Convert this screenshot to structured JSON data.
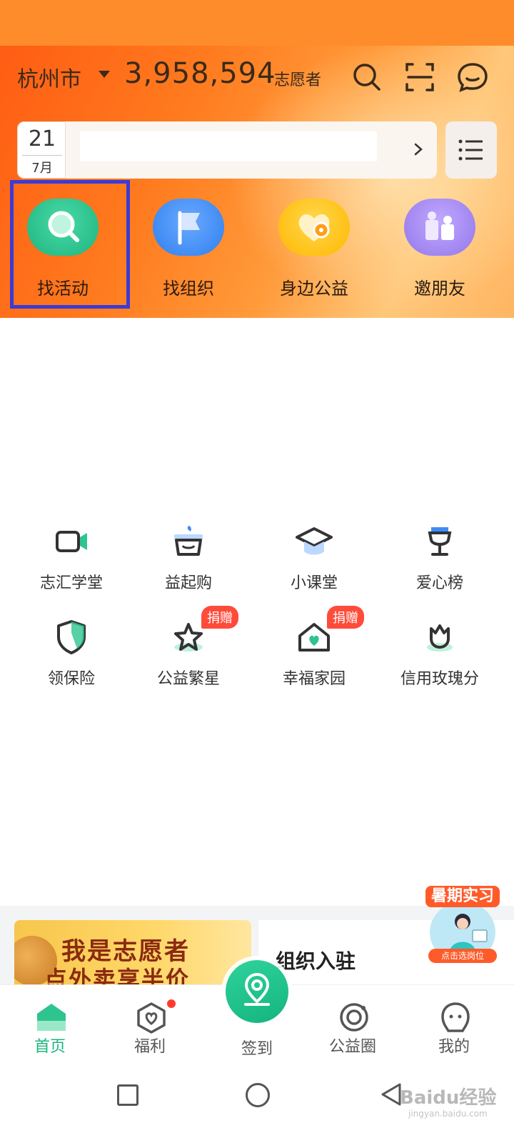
{
  "header": {
    "city": "杭州市",
    "volunteer_count": "3,958,594",
    "volunteer_label": "志愿者"
  },
  "notice": {
    "day": "21",
    "month": "7月"
  },
  "quick_nav": [
    {
      "label": "找活动",
      "icon": "search-icon",
      "color": "#2ec48f"
    },
    {
      "label": "找组织",
      "icon": "flag-icon",
      "color": "#3b8df5"
    },
    {
      "label": "身边公益",
      "icon": "heart-location-icon",
      "color": "#ffc21a"
    },
    {
      "label": "邀朋友",
      "icon": "friends-icon",
      "color": "#a589f0"
    }
  ],
  "shortcuts": [
    {
      "label": "志汇学堂",
      "icon": "video-icon"
    },
    {
      "label": "益起购",
      "icon": "basket-icon"
    },
    {
      "label": "小课堂",
      "icon": "graduation-cap-icon"
    },
    {
      "label": "爱心榜",
      "icon": "trophy-icon"
    },
    {
      "label": "领保险",
      "icon": "shield-icon"
    },
    {
      "label": "公益繁星",
      "icon": "star-icon",
      "badge": "捐赠"
    },
    {
      "label": "幸福家园",
      "icon": "home-icon",
      "badge": "捐赠"
    },
    {
      "label": "信用玫瑰分",
      "icon": "rose-icon"
    }
  ],
  "banner": {
    "left_line1": "我是志愿者",
    "left_line2": "点外卖享半价",
    "right_title": "组织入驻"
  },
  "summer": {
    "title": "暑期实习",
    "cta": "点击选岗位"
  },
  "tabbar": {
    "tabs": [
      {
        "label": "首页",
        "active": true
      },
      {
        "label": "福利",
        "active": false
      },
      {
        "label": "签到",
        "active": false
      },
      {
        "label": "公益圈",
        "active": false
      },
      {
        "label": "我的",
        "active": false
      }
    ]
  },
  "watermark": {
    "text": "Baidu经验",
    "sub": "jingyan.baidu.com"
  },
  "colors": {
    "accent_green": "#1cb57e",
    "highlight_box": "#3b3ad6",
    "header_orange": "#ff6a16"
  }
}
